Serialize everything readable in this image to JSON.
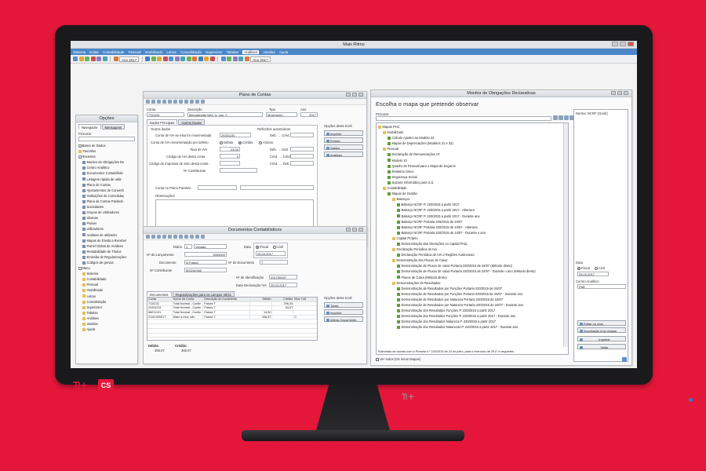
{
  "window": {
    "title": "Mais Ritmo"
  },
  "menu": [
    "Sistema",
    "Editar",
    "Contabilidade",
    "Pessoal",
    "Imobilizado",
    "Letras",
    "Consolidação",
    "Supervisor",
    "Tabelas",
    "Análises",
    "Janelas",
    "Ajuda"
  ],
  "menu_active_index": 9,
  "toolbar": {
    "year1": "Ano 2017",
    "year2": "Ano 2017"
  },
  "options_panel": {
    "title": "Opções",
    "tabs": [
      "Navegador",
      "Mensagens"
    ],
    "search_label": "Procurar:",
    "tree": [
      {
        "level": 0,
        "type": "exp",
        "label": "Bases de Dados"
      },
      {
        "level": 0,
        "type": "folder",
        "label": "Favoritos"
      },
      {
        "level": 0,
        "type": "exp",
        "label": "Recentes"
      },
      {
        "level": 1,
        "type": "file",
        "label": "Monitor de Obrigações De"
      },
      {
        "level": 1,
        "type": "file",
        "label": "Centro Analítico"
      },
      {
        "level": 1,
        "type": "file",
        "label": "Documentos Contabilístic"
      },
      {
        "level": 1,
        "type": "file",
        "label": "Listagem rápida de utiliz"
      },
      {
        "level": 1,
        "type": "file",
        "label": "Plano de Contas"
      },
      {
        "level": 1,
        "type": "file",
        "label": "Ajustamentos de Converã"
      },
      {
        "level": 1,
        "type": "file",
        "label": "Instituições de Consolidaç"
      },
      {
        "level": 1,
        "type": "file",
        "label": "Plano de Contas Paralelo"
      },
      {
        "level": 1,
        "type": "file",
        "label": "Sociedades"
      },
      {
        "level": 1,
        "type": "file",
        "label": "Grupos de Utilizadores"
      },
      {
        "level": 1,
        "type": "file",
        "label": "Idiomas"
      },
      {
        "level": 1,
        "type": "file",
        "label": "Países"
      },
      {
        "level": 1,
        "type": "file",
        "label": "Utilizadores"
      },
      {
        "level": 1,
        "type": "file",
        "label": "Análises de utilizador"
      },
      {
        "level": 1,
        "type": "file",
        "label": "Mapas de Dívida a Receber"
      },
      {
        "level": 1,
        "type": "file",
        "label": "Painel Global de Análises"
      },
      {
        "level": 1,
        "type": "file",
        "label": "Rentabilidade de Títulos"
      },
      {
        "level": 1,
        "type": "file",
        "label": "Emissão de Regularizações"
      },
      {
        "level": 1,
        "type": "file",
        "label": "Códigos de grevas"
      },
      {
        "level": 0,
        "type": "exp",
        "label": "Menu"
      },
      {
        "level": 1,
        "type": "folder",
        "label": "Sistema"
      },
      {
        "level": 1,
        "type": "folder",
        "label": "Contabilidade"
      },
      {
        "level": 1,
        "type": "folder",
        "label": "Pessoal"
      },
      {
        "level": 1,
        "type": "folder",
        "label": "Imobilizado"
      },
      {
        "level": 1,
        "type": "folder",
        "label": "Letras"
      },
      {
        "level": 1,
        "type": "folder",
        "label": "Consolidação"
      },
      {
        "level": 1,
        "type": "folder",
        "label": "Supervisor"
      },
      {
        "level": 1,
        "type": "folder",
        "label": "Tabelas"
      },
      {
        "level": 1,
        "type": "folder",
        "label": "Análises"
      },
      {
        "level": 1,
        "type": "folder",
        "label": "Janelas"
      },
      {
        "level": 1,
        "type": "folder",
        "label": "Ajuda"
      }
    ]
  },
  "plano": {
    "title": "Plano de Contas",
    "lbl_conta": "Conta",
    "lbl_descricao": "Descrição",
    "lbl_tipo": "Tipo",
    "lbl_ano": "Ano",
    "conta": "7111131",
    "descricao": "Mercadorias NAC lv. non. C",
    "tipo": "Movimento",
    "ano": "2017",
    "tabs": [
      "Dados Principais",
      "Outros Dados"
    ],
    "outros_dados": "Outros dados",
    "reflexoes": "Reflexões automáticas",
    "lbl_conta_iva": "Conta de IVA se esta for movimentada",
    "conta_iva": "24331131",
    "lbl_deb_cred1": "Déb. → Créd.",
    "lbl_conta_mov": "Conta de IVA movimentação por defeito",
    "radio_debito": "Débito",
    "radio_credito": "Crédito",
    "radio_ambos": "Ambos",
    "lbl_taxa": "Taxa de IVA",
    "taxa": "23,00",
    "lbl_deb_cred2": "Déb. → Déb.",
    "lbl_codigo_iva": "Código de IVA desta conta",
    "codigo_iva": "9",
    "lbl_cred_cred": "Créd. → Créd.",
    "lbl_codigo_impostos": "Código de Impostos de Selo desta conta",
    "lbl_cred_deb": "Créd. → Deb.",
    "lbl_contribuinte": "Nº Contribuinte",
    "lbl_paralelo": "Conta no Plano Paralelo",
    "lbl_observacoes": "Observações",
    "lbl_taxonomia": "Código de Taxonomia",
    "taxonomia": "509",
    "taxonomia_desc": "Vendas - Mercadorias",
    "opcoes_title": "Opções deste Ecrã",
    "opcoes": [
      "Imprimir",
      "Extrato",
      "Saldos",
      "Análises"
    ],
    "marcada": "Marcada"
  },
  "docs": {
    "title": "Documentos Contabilísticos",
    "lbl_diario": "Diário",
    "diario_num": "1",
    "diario_nome": "Vendas",
    "lbl_data": "Data",
    "radio_fiscal": "Fiscal",
    "radio_civil": "Civil",
    "data": "25.03.2017",
    "lbl_lancamento": "Nº do Lançamento",
    "lancamento": "3000002",
    "lbl_documento": "Nº do Documento",
    "documento_num": "7",
    "lbl_doc_nome": "Documento",
    "doc_nome": "N.Fatura",
    "lbl_contribuinte": "Nº Contribuinte",
    "contribuinte": "502242342",
    "lbl_identificacao": "Nº de Identificação",
    "identificacao": "201700007",
    "lbl_data_iva": "Data Declaração IVA",
    "data_iva": "25.03.2017",
    "tabs": [
      "Documentos",
      "Regularizações para os campos 40/41"
    ],
    "columns": [
      "Conta",
      "Nome da Conta",
      "Descrição do movimento",
      "Débito",
      "Crédito",
      "Mov. IVA"
    ],
    "rows": [
      [
        "7111131",
        "Total Normal - Contin",
        "Fatura 7",
        "",
        "296,00",
        ""
      ],
      [
        "24331131",
        "Total Normal - Contin",
        "Fatura 7",
        "",
        "63,57",
        ""
      ],
      [
        "68211131",
        "Total Normal - Contin",
        "Fatura 7",
        "14,50",
        "",
        ""
      ],
      [
        "21111000017",
        "Marc a mov. são",
        "Fatura 7",
        "336,87",
        "",
        "C"
      ]
    ],
    "lbl_debito": "Débito",
    "lbl_credito": "Crédito",
    "total_debito": "355,07",
    "total_credito": "355,07",
    "opcoes_title": "Opções deste Ecrã",
    "opcoes": [
      "Totais",
      "Imprimir",
      "Alterar Documento"
    ]
  },
  "monitor": {
    "title": "Monitor de Obrigações Declarativas",
    "heading": "Escolha o mapa que pretende observar",
    "search_label": "Procurar:",
    "tree": [
      {
        "level": 0,
        "type": "folder",
        "label": "Mapas PHC"
      },
      {
        "level": 1,
        "type": "folder",
        "label": "Imobilizado"
      },
      {
        "level": 2,
        "type": "report",
        "label": "Cálculo Ajustes ao Modelo 22"
      },
      {
        "level": 2,
        "type": "report",
        "label": "Mapas de Depreciações (Modelos 31 e 32)"
      },
      {
        "level": 1,
        "type": "folder",
        "label": "Pessoal"
      },
      {
        "level": 2,
        "type": "report",
        "label": "Declaração de Remunerações AT"
      },
      {
        "level": 2,
        "type": "report",
        "label": "Modelo 10"
      },
      {
        "level": 2,
        "type": "report",
        "label": "Quadro de Pessoal para o Mapa de Seguros"
      },
      {
        "level": 2,
        "type": "report",
        "label": "Relatório Único"
      },
      {
        "level": 2,
        "type": "report",
        "label": "Segurança Social"
      },
      {
        "level": 2,
        "type": "report",
        "label": "Suporte Informático para S.S."
      },
      {
        "level": 1,
        "type": "folder",
        "label": "Contabilidade"
      },
      {
        "level": 2,
        "type": "report",
        "label": "Mapas de Gestão"
      },
      {
        "level": 3,
        "type": "folder",
        "label": "Balanços"
      },
      {
        "level": 4,
        "type": "report",
        "label": "Balanço NCRF P. 220/2015 a partir 2017"
      },
      {
        "level": 4,
        "type": "report",
        "label": "Balanço NCRF P. 220/2015 a partir 2017 - Abertura"
      },
      {
        "level": 4,
        "type": "report",
        "label": "Balanço NCRF P. 220/2015 a partir 2017 - Durante ano"
      },
      {
        "level": 4,
        "type": "report",
        "label": "Balanço NCRF Portaria 220/2015 de 24/07"
      },
      {
        "level": 4,
        "type": "report",
        "label": "Balanço NCRF Portaria 220/2015 de 24/07 - Abertura"
      },
      {
        "level": 4,
        "type": "report",
        "label": "Balanço NCRF Portaria 220/2015 de 24/07 - Durante o ano"
      },
      {
        "level": 3,
        "type": "folder",
        "label": "Capital Próprio"
      },
      {
        "level": 4,
        "type": "report",
        "label": "Demonstração das Alterações no Capital Próp."
      },
      {
        "level": 3,
        "type": "folder",
        "label": "Declaração Periódica de Iva"
      },
      {
        "level": 4,
        "type": "report",
        "label": "Declaração Periódica de IVA e Regiões Autónomas"
      },
      {
        "level": 3,
        "type": "folder",
        "label": "Demonstração dos Fluxos de Caixa"
      },
      {
        "level": 4,
        "type": "report",
        "label": "Demonstração de Fluxos de caixa Portaria 220/2015 de 24/07 (Método direto)"
      },
      {
        "level": 4,
        "type": "report",
        "label": "Demonstração de Fluxos de caixa Portaria 220/2015 de 24/07 - Durante o ano (Método direto)"
      },
      {
        "level": 4,
        "type": "report",
        "label": "Fluxos de Caixa (Método direto)"
      },
      {
        "level": 3,
        "type": "folder",
        "label": "Demonstrações de Resultados"
      },
      {
        "level": 4,
        "type": "report",
        "label": "Demonstração de Resultados por Funções Portaria 220/2015 de 24/07"
      },
      {
        "level": 4,
        "type": "report",
        "label": "Demonstração de Resultados por Funções Portaria 220/2015 de 24/07 - Durante ano"
      },
      {
        "level": 4,
        "type": "report",
        "label": "Demonstração de Resultados por Natureza Portaria 220/2015 de 24/07"
      },
      {
        "level": 4,
        "type": "report",
        "label": "Demonstração de Resultados por Natureza Portaria 220/2015 de 24/07 - Durante ano"
      },
      {
        "level": 4,
        "type": "report",
        "label": "Demonstração dos Resultados Funções P. 220/2015 a partir 2017"
      },
      {
        "level": 4,
        "type": "report",
        "label": "Demonstração dos Resultados Funções P. 220/2015 a partir 2017 - Durante ano"
      },
      {
        "level": 4,
        "type": "report",
        "label": "Demonstração dos Resultados Natureza P. 220/2015 a partir 2017"
      },
      {
        "level": 4,
        "type": "report",
        "label": "Demonstração dos Resultados Naturezas P. 220/2015 a partir 2017 - Durante ano"
      }
    ],
    "footer_note": "Elaborado de acordo com a Portaria n.º 220/2015 de 24 de julho, para o exercício de 2017 e seguintes.",
    "ver_todos": "Ver todos (Os meus Mapas)",
    "side_title": "Norma: NCRF (Geral)",
    "lbl_data": "Data",
    "radio_fiscal": "Fiscal",
    "radio_civil": "Civil",
    "data": "25.03.2017",
    "lbl_centro": "Centro Analítico",
    "centro": "PAB",
    "btn_editar": "Editar ou criar",
    "btn_importacao": "Importação e/ou mapas",
    "btn_imprimir": "Imprimir",
    "btn_voltar": "Voltar"
  },
  "colors": {
    "brand_red": "#e4173a",
    "menu_blue": "#4a86c8"
  }
}
